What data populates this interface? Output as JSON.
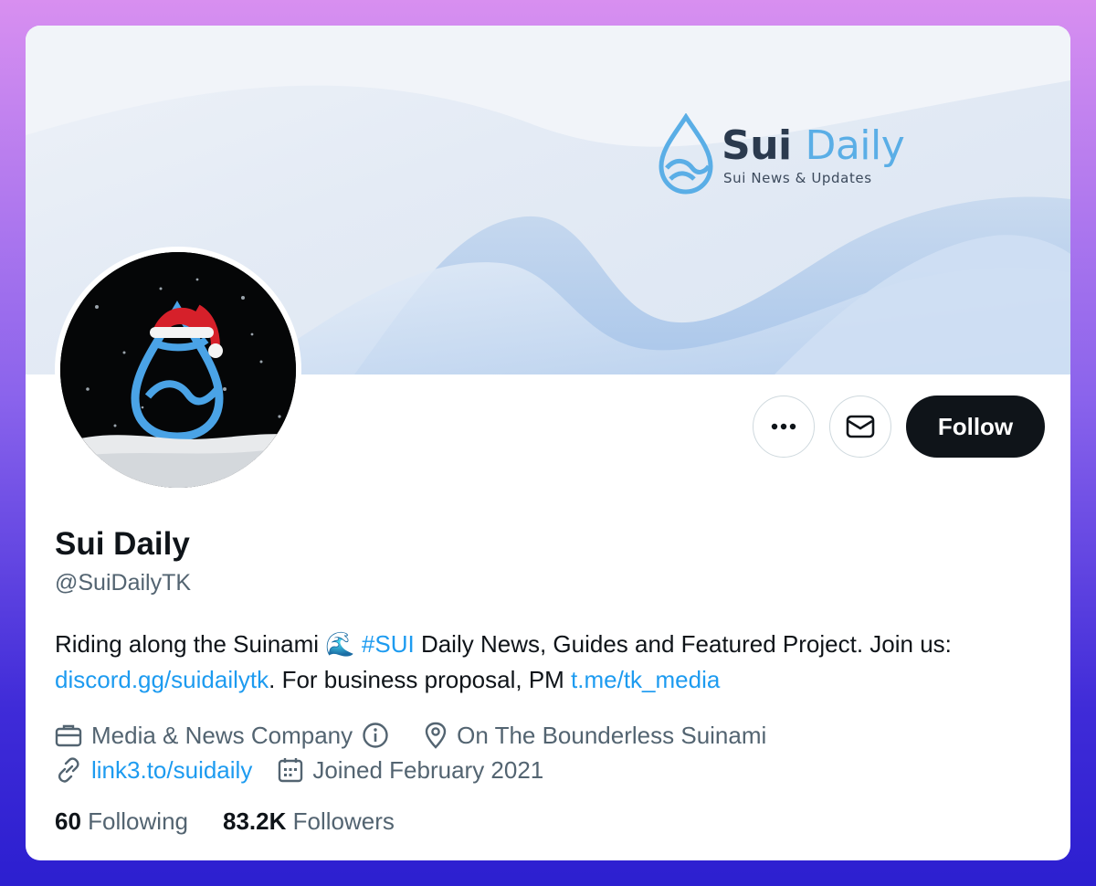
{
  "banner": {
    "brand_title_1": "Sui",
    "brand_title_2": "Daily",
    "brand_subtitle": "Sui News & Updates"
  },
  "actions": {
    "more_icon": "more-horizontal-icon",
    "message_icon": "envelope-icon",
    "follow_label": "Follow"
  },
  "profile": {
    "name": "Sui Daily",
    "handle": "@SuiDailyTK",
    "bio_text_1": "Riding along the Suinami ",
    "bio_emoji": "🌊",
    "bio_hashtag": "#SUI",
    "bio_text_2": " Daily News, Guides and Featured Project. Join us: ",
    "bio_link_1": "discord.gg/suidailytk",
    "bio_text_3": ". For business proposal, PM ",
    "bio_link_2": "t.me/tk_media",
    "category": "Media & News Company",
    "location": "On The Bounderless Suinami",
    "website": "link3.to/suidaily",
    "joined": "Joined February 2021"
  },
  "stats": {
    "following_count": "60",
    "following_label": "Following",
    "followers_count": "83.2K",
    "followers_label": "Followers"
  },
  "colors": {
    "link": "#1d9bf0",
    "primary_text": "#0f1419",
    "secondary_text": "#536471",
    "follow_button": "#0f1419"
  }
}
